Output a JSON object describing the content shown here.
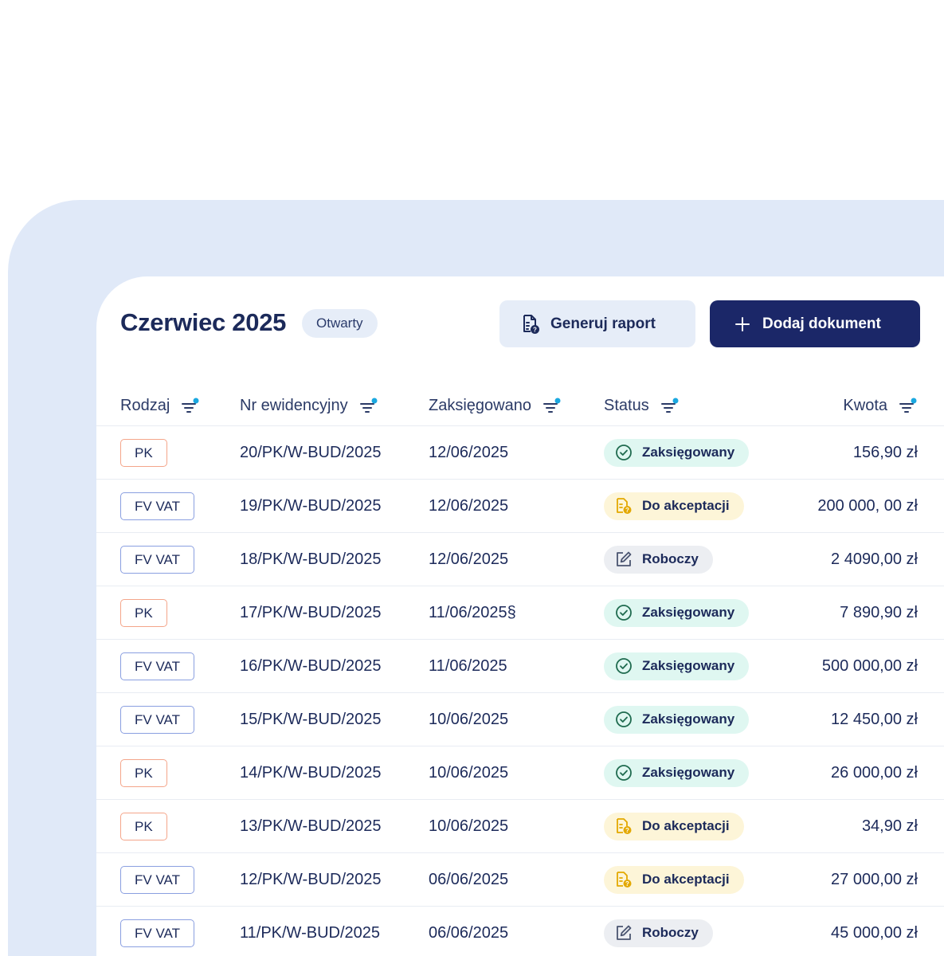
{
  "header": {
    "title": "Czerwiec 2025",
    "period_status": "Otwarty",
    "report_button": "Generuj raport",
    "add_button": "Dodaj dokument",
    "icons": {
      "report": "report-document-icon",
      "add": "plus-icon"
    }
  },
  "table": {
    "columns": {
      "type": "Rodzaj",
      "number": "Nr ewidencyjny",
      "posted": "Zaksięgowano",
      "status": "Status",
      "amount": "Kwota"
    },
    "rows": [
      {
        "type": "PK",
        "kind": "pk",
        "number": "20/PK/W-BUD/2025",
        "date": "12/06/2025",
        "status": "Zaksięgowany",
        "status_kind": "posted",
        "amount": "156,90 zł"
      },
      {
        "type": "FV VAT",
        "kind": "fv",
        "number": "19/PK/W-BUD/2025",
        "date": "12/06/2025",
        "status": "Do akceptacji",
        "status_kind": "pending",
        "amount": "200 000, 00 zł"
      },
      {
        "type": "FV VAT",
        "kind": "fv",
        "number": "18/PK/W-BUD/2025",
        "date": "12/06/2025",
        "status": "Roboczy",
        "status_kind": "draft",
        "amount": "2 4090,00 zł"
      },
      {
        "type": "PK",
        "kind": "pk",
        "number": "17/PK/W-BUD/2025",
        "date": "11/06/2025§",
        "status": "Zaksięgowany",
        "status_kind": "posted",
        "amount": "7 890,90 zł"
      },
      {
        "type": "FV VAT",
        "kind": "fv",
        "number": "16/PK/W-BUD/2025",
        "date": "11/06/2025",
        "status": "Zaksięgowany",
        "status_kind": "posted",
        "amount": "500 000,00 zł"
      },
      {
        "type": "FV VAT",
        "kind": "fv",
        "number": "15/PK/W-BUD/2025",
        "date": "10/06/2025",
        "status": "Zaksięgowany",
        "status_kind": "posted",
        "amount": "12 450,00 zł"
      },
      {
        "type": "PK",
        "kind": "pk",
        "number": "14/PK/W-BUD/2025",
        "date": "10/06/2025",
        "status": "Zaksięgowany",
        "status_kind": "posted",
        "amount": "26 000,00 zł"
      },
      {
        "type": "PK",
        "kind": "pk",
        "number": "13/PK/W-BUD/2025",
        "date": "10/06/2025",
        "status": "Do akceptacji",
        "status_kind": "pending",
        "amount": "34,90 zł"
      },
      {
        "type": "FV VAT",
        "kind": "fv",
        "number": "12/PK/W-BUD/2025",
        "date": "06/06/2025",
        "status": "Do akceptacji",
        "status_kind": "pending",
        "amount": "27 000,00 zł"
      },
      {
        "type": "FV VAT",
        "kind": "fv",
        "number": "11/PK/W-BUD/2025",
        "date": "06/06/2025",
        "status": "Roboczy",
        "status_kind": "draft",
        "amount": "45 000,00 zł"
      }
    ]
  },
  "colors": {
    "primary": "#1b2768",
    "accent_dot": "#1aa8e0",
    "posted_bg": "#dff7f1",
    "posted_icon": "#1f6b4f",
    "pending_bg": "#fdf5d8",
    "pending_icon": "#e3a800",
    "draft_bg": "#eceef2",
    "pk_border": "#f4a58a",
    "fv_border": "#8a9fe0"
  }
}
